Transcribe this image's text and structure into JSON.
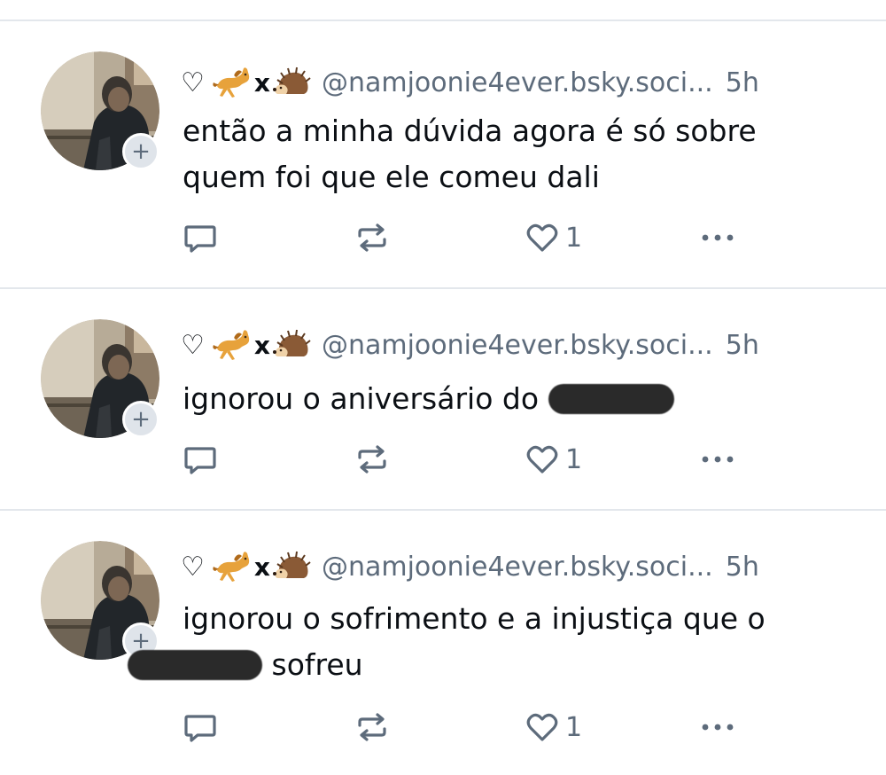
{
  "colors": {
    "text": "#0b0f14",
    "muted": "#5d6b7b",
    "separator": "#e3e7ec",
    "redaction": "#2a2a2a",
    "avatar_plus_bg": "#dfe4ea"
  },
  "posts": [
    {
      "display_name_prefix": "♡",
      "display_name_separator": "x",
      "display_name_emojis": [
        "horse-emoji",
        "hedgehog-emoji"
      ],
      "handle": "@namjoonie4ever.bsky.soci...",
      "time": "5h",
      "text_line1": "então a minha dúvida agora é só sobre",
      "text_line2": "quem foi que ele comeu dali",
      "like_count": "1",
      "icons": [
        "reply-icon",
        "repost-icon",
        "like-icon",
        "more-icon"
      ]
    },
    {
      "display_name_prefix": "♡",
      "display_name_separator": "x",
      "display_name_emojis": [
        "horse-emoji",
        "hedgehog-emoji"
      ],
      "handle": "@namjoonie4ever.bsky.soci...",
      "time": "5h",
      "text_line1": "ignorou o aniversário do",
      "like_count": "1",
      "icons": [
        "reply-icon",
        "repost-icon",
        "like-icon",
        "more-icon"
      ]
    },
    {
      "display_name_prefix": "♡",
      "display_name_separator": "x",
      "display_name_emojis": [
        "horse-emoji",
        "hedgehog-emoji"
      ],
      "handle": "@namjoonie4ever.bsky.soci...",
      "time": "5h",
      "text_line1": "ignorou o sofrimento e a injustiça que o",
      "text_line2": "sofreu",
      "like_count": "1",
      "icons": [
        "reply-icon",
        "repost-icon",
        "like-icon",
        "more-icon"
      ]
    }
  ]
}
